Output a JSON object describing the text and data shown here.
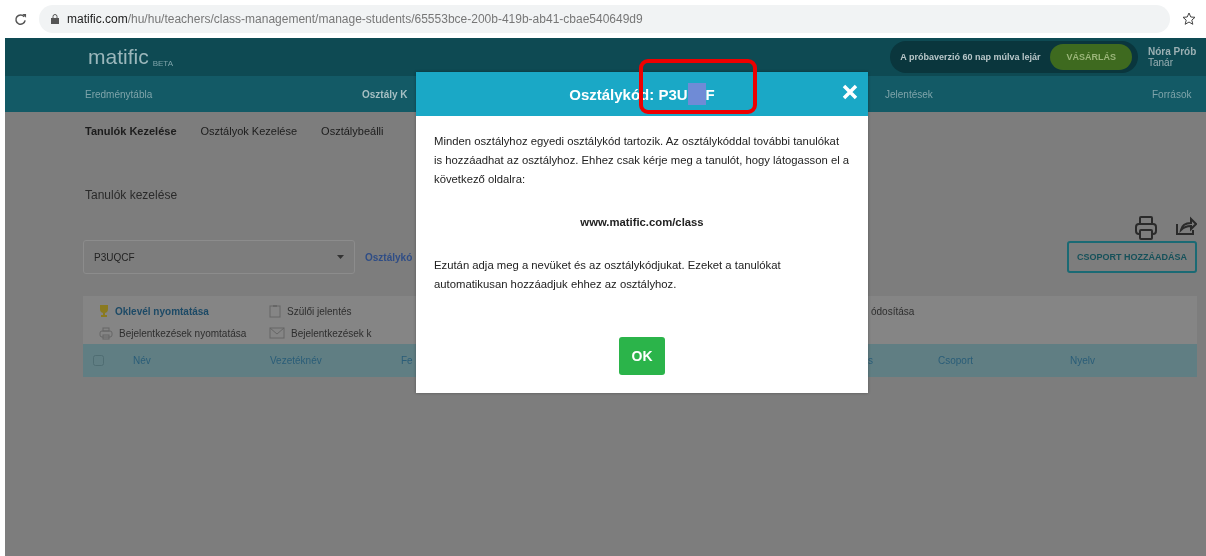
{
  "browser": {
    "url_host": "matific.com",
    "url_path": "/hu/hu/teachers/class-management/manage-students/65553bce-200b-419b-ab41-cbae540649d9"
  },
  "header": {
    "logo": "matific",
    "logo_tag": "BETA",
    "trial_notice": "A próbaverzió 60 nap múlva lejár",
    "buy_button": "VÁSÁRLÁS",
    "user_name": "Nóra Prób",
    "user_role": "Tanár"
  },
  "nav": [
    {
      "label": "Eredménytábla",
      "selected": false
    },
    {
      "label": "Osztály K",
      "selected": true
    },
    {
      "label": "Jelentések",
      "selected": false
    },
    {
      "label": "Források",
      "selected": false
    }
  ],
  "subnav": [
    {
      "label": "Tanulók Kezelése",
      "selected": true
    },
    {
      "label": "Osztályok Kezelése",
      "selected": false
    },
    {
      "label": "Osztálybeálli",
      "selected": false
    }
  ],
  "page_title": "Tanulók kezelése",
  "class_select": {
    "value": "P3UQCF"
  },
  "class_code_link": "Osztálykó",
  "add_group_button": "CSOPORT HOZZÁADÁSA",
  "actions": [
    {
      "kind": "trophy",
      "label": "Oklevél nyomtatása",
      "disabled": false
    },
    {
      "kind": "clipboard",
      "label": "Szülői jelentés",
      "disabled": true
    },
    {
      "kind": "plain",
      "label": "ódosítása",
      "disabled": true
    },
    {
      "kind": "printer",
      "label": "Bejelentkezések nyomtatása",
      "disabled": true
    },
    {
      "kind": "envelope",
      "label": "Bejelentkezések k",
      "disabled": true
    }
  ],
  "table": {
    "select_all_checked": false,
    "columns": [
      "Név",
      "Vezetéknév",
      "Fe",
      "s",
      "Csoport",
      "Nyelv"
    ]
  },
  "modal": {
    "title": "Osztálykód: P3U",
    "title_tail": "F",
    "intro": "Minden osztályhoz egyedi osztálykód tartozik. Az osztálykóddal további tanulókat is hozzáadhat az osztályhoz. Ehhez csak kérje meg a tanulót, hogy látogasson el a következő oldalra:",
    "link": "www.matific.com/class",
    "outro": "Ezután adja meg a nevüket és az osztálykódjukat. Ezeket a tanulókat automatikusan hozzáadjuk ehhez az osztályhoz.",
    "ok_button": "OK"
  }
}
